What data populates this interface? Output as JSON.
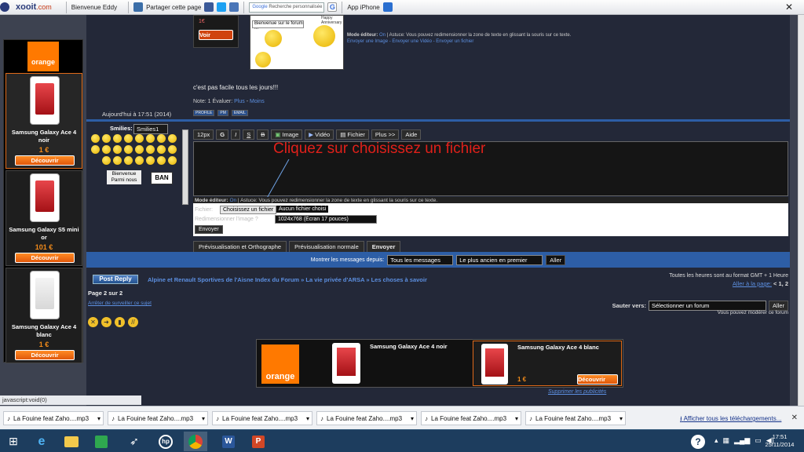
{
  "toolbar": {
    "logo": "xooit",
    "logo_suffix": ".com",
    "welcome": "Bienvenue Eddy",
    "share": "Partager cette page",
    "google": "Google",
    "search_placeholder": "Recherche personnalisée",
    "app": "App iPhone"
  },
  "left_ad": {
    "brand": "orange",
    "items": [
      {
        "name": "Samsung Galaxy Ace 4 noir",
        "price": "1 €",
        "button": "Découvrir"
      },
      {
        "name": "Samsung Galaxy S5 mini or",
        "price": "101 €",
        "button": "Découvrir"
      },
      {
        "name": "Samsung Galaxy Ace 4 blanc",
        "price": "1 €",
        "button": "Découvrir"
      }
    ]
  },
  "post": {
    "voir": "Voir",
    "euro": "1€",
    "bubble": "Bienvenue sur le forum ...",
    "anniv": "Happy Anniversary",
    "mode_label": "Mode éditeur:",
    "mode_on": "On",
    "astuce_top": "Astuce: Vous pouvez redimensionner la zone de texte en glissant la souris sur ce texte.",
    "links": "Envoyer une Image - Envoyer une Vidéo - Envoyer un fichier",
    "message": "c'est pas facile tous les jours!!!",
    "note": "Note: 1",
    "evaluer": "Évaluer:",
    "plus": "Plus",
    "moins": "Moins",
    "profile": "PROFILE",
    "pm": "PM",
    "email": "EMAIL"
  },
  "timestamp": "Aujourd'hui à 17:51 (2014)",
  "reply": {
    "smilies_label": "Smilies:",
    "smilies_select": "Smilies1",
    "size": "12px",
    "buttons": [
      "G",
      "I",
      "S",
      "B"
    ],
    "image": "Image",
    "video": "Vidéo",
    "fichier": "Fichier",
    "plus": "Plus >>",
    "aide": "Aide",
    "overlay": "Cliquez sur choisissez un fichier",
    "bienvenue": "Bienvenue Parmi nous",
    "ban": "BAN",
    "mode_label": "Mode éditeur:",
    "mode_on": "On",
    "astuce": "Astuce: Vous pouvez redimensionner la zone de texte en glissant la souris sur ce texte.",
    "fichier_label": "Fichier:",
    "choose_btn": "Choisissez un fichier",
    "no_file": "Aucun fichier choisi",
    "resize_label": "Redimensionner l'image ?",
    "resize_value": "1024x768 (Écran 17 pouces)",
    "envoyer_small": "Envoyer",
    "preview_spell": "Prévisualisation et Orthographe",
    "preview_normal": "Prévisualisation normale",
    "send": "Envoyer"
  },
  "filter": {
    "label": "Montrer les messages depuis:",
    "since": "Tous les messages",
    "order": "Le plus ancien en premier",
    "go": "Aller"
  },
  "nav": {
    "post_reply": "Post Reply",
    "breadcrumb": "Alpine et Renault Sportives de l'Aisne Index du Forum » La vie privée d'ARSA » Les choses à savoir",
    "timezone": "Toutes les heures sont au format GMT + 1 Heure",
    "goto": "Aller à la page:",
    "pages": "<  1, 2",
    "page_info": "Page 2 sur 2",
    "stop_watch": "Arrêter de surveiller ce sujet",
    "jump_label": "Sauter vers:",
    "jump_value": "Sélectionner un forum",
    "jump_go": "Aller",
    "moderate": "Vous pouvez modérer ce forum"
  },
  "bottom_ad": {
    "brand": "orange",
    "item1": "Samsung Galaxy Ace 4 noir",
    "item2": "Samsung Galaxy Ace 4 blanc",
    "price": "1 €",
    "button": "Découvrir",
    "suppress": "Supprimer les publicités"
  },
  "status": "javascript:void(0)",
  "downloads": {
    "items": [
      "La Fouine feat Zaho....mp3",
      "La Fouine feat Zaho....mp3",
      "La Fouine feat Zaho....mp3",
      "La Fouine feat Zaho....mp3",
      "La Fouine feat Zaho....mp3",
      "La Fouine feat Zaho....mp3"
    ],
    "show_all": "Afficher tous les téléchargements..."
  },
  "clock": {
    "time": "17:51",
    "date": "25/11/2014"
  },
  "colors": {
    "accent": "#f28b1a",
    "overlay": "#e0201a",
    "link": "#5c8fe0"
  }
}
